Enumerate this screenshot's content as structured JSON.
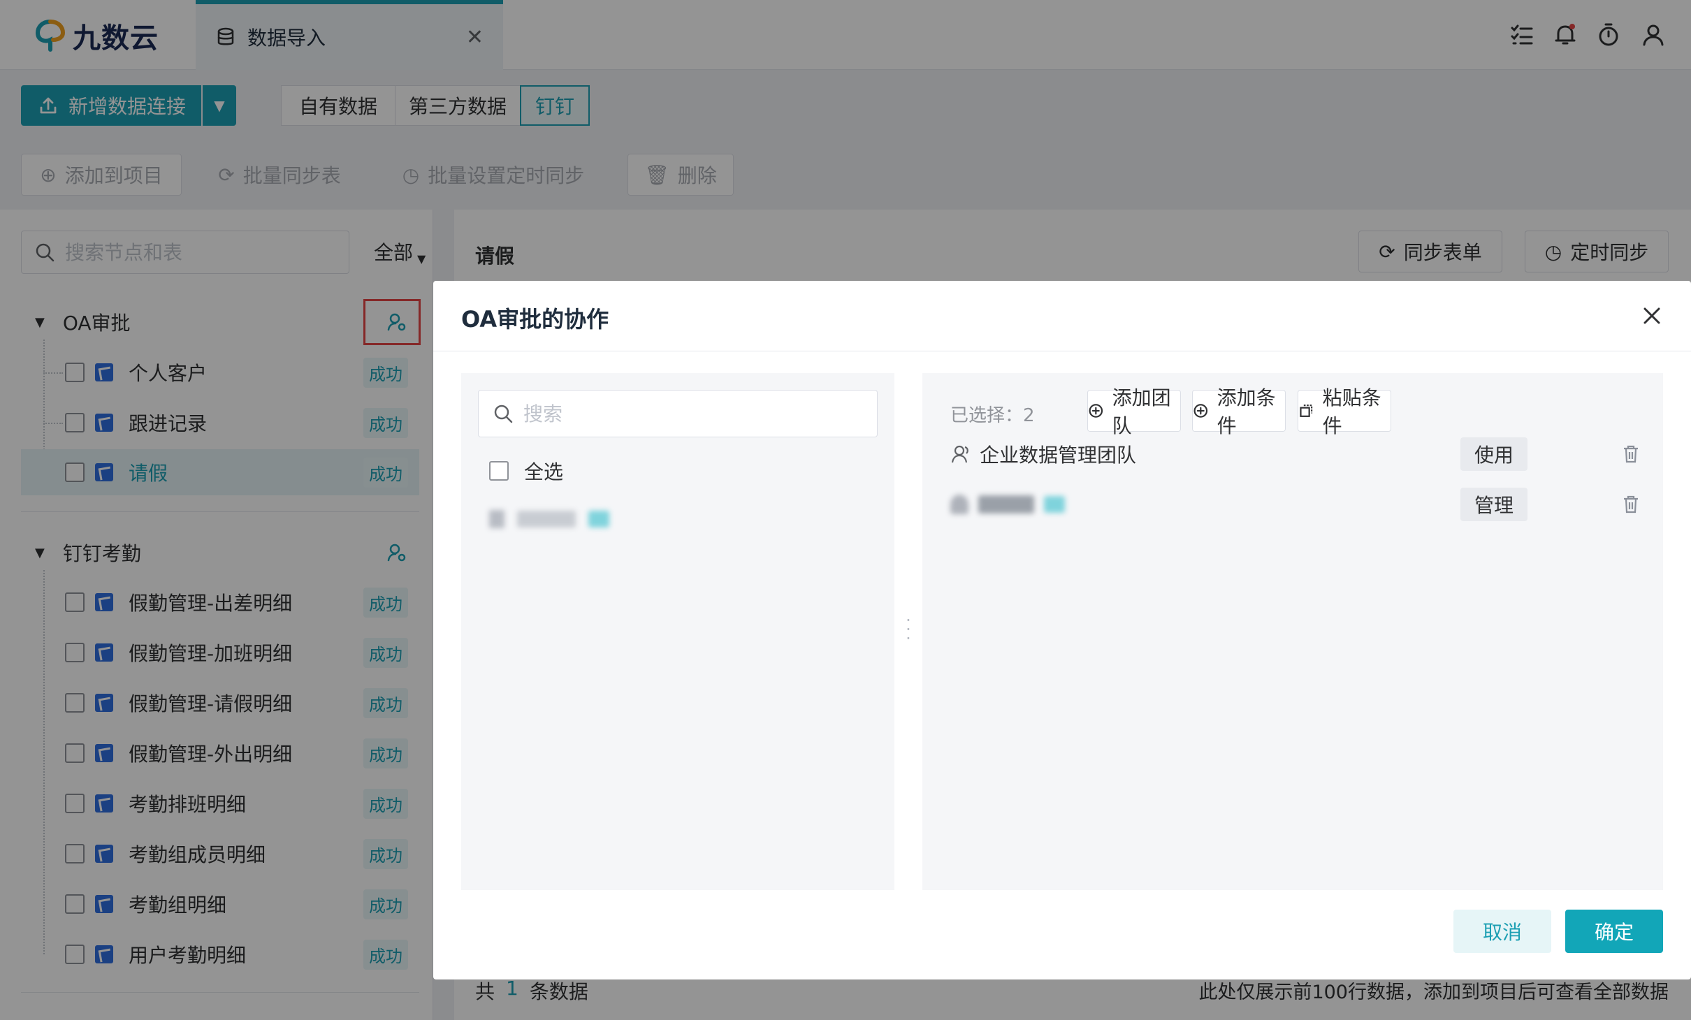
{
  "app": {
    "logo_text": "九数云"
  },
  "tabs": [
    {
      "label": "数据导入"
    }
  ],
  "toolbar": {
    "new_connection": "新增数据连接",
    "segments": [
      "自有数据",
      "第三方数据",
      "钉钉"
    ],
    "active_segment": "钉钉",
    "actions": [
      "添加到项目",
      "批量同步表",
      "批量设置定时同步",
      "删除"
    ]
  },
  "tree": {
    "search_placeholder": "搜索节点和表",
    "filter": "全部",
    "groups": [
      {
        "name": "OA审批",
        "items": [
          {
            "name": "个人客户",
            "status": "成功"
          },
          {
            "name": "跟进记录",
            "status": "成功"
          },
          {
            "name": "请假",
            "status": "成功",
            "selected": true
          }
        ]
      },
      {
        "name": "钉钉考勤",
        "items": [
          {
            "name": "假勤管理-出差明细",
            "status": "成功"
          },
          {
            "name": "假勤管理-加班明细",
            "status": "成功"
          },
          {
            "name": "假勤管理-请假明细",
            "status": "成功"
          },
          {
            "name": "假勤管理-外出明细",
            "status": "成功"
          },
          {
            "name": "考勤排班明细",
            "status": "成功"
          },
          {
            "name": "考勤组成员明细",
            "status": "成功"
          },
          {
            "name": "考勤组明细",
            "status": "成功"
          },
          {
            "name": "用户考勤明细",
            "status": "成功"
          }
        ]
      }
    ]
  },
  "main": {
    "title": "请假",
    "sync_button": "同步表单",
    "schedule_button": "定时同步",
    "footer_prefix": "共",
    "footer_count": "1",
    "footer_suffix": "条数据",
    "footer_note": "此处仅展示前100行数据，添加到项目后可查看全部数据"
  },
  "dialog": {
    "title": "OA审批的协作",
    "search_placeholder": "搜索",
    "select_all": "全选",
    "selected_count": "已选择：2",
    "add_team": "添加团队",
    "add_condition": "添加条件",
    "paste_condition": "粘贴条件",
    "selected": [
      {
        "name": "企业数据管理团队",
        "permission": "使用"
      },
      {
        "name": "",
        "permission": "管理",
        "blurred": true
      }
    ],
    "cancel": "取消",
    "confirm": "确定"
  },
  "colors": {
    "accent": "#1c9fb3",
    "highlight": "#e54545",
    "table_icon": "#2f6fe0"
  }
}
